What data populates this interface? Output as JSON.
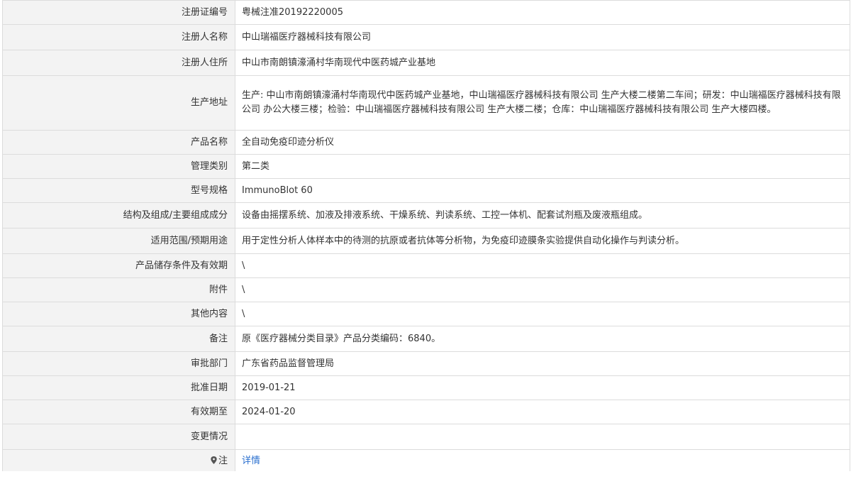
{
  "rows": [
    {
      "label": "注册证编号",
      "value": "粤械注准20192220005"
    },
    {
      "label": "注册人名称",
      "value": "中山瑞福医疗器械科技有限公司"
    },
    {
      "label": "注册人住所",
      "value": "中山市南朗镇濠涌村华南现代中医药城产业基地"
    },
    {
      "label": "生产地址",
      "value": "生产: 中山市南朗镇濠涌村华南现代中医药城产业基地，中山瑞福医疗器械科技有限公司 生产大楼二楼第二车间；研发：中山瑞福医疗器械科技有限公司 办公大楼三楼；检验：中山瑞福医疗器械科技有限公司 生产大楼二楼；仓库：中山瑞福医疗器械科技有限公司 生产大楼四楼。"
    },
    {
      "label": "产品名称",
      "value": "全自动免疫印迹分析仪"
    },
    {
      "label": "管理类别",
      "value": "第二类"
    },
    {
      "label": "型号规格",
      "value": "ImmunoBlot 60"
    },
    {
      "label": "结构及组成/主要组成成分",
      "value": "设备由摇摆系统、加液及排液系统、干燥系统、判读系统、工控一体机、配套试剂瓶及废液瓶组成。"
    },
    {
      "label": "适用范围/预期用途",
      "value": "用于定性分析人体样本中的待测的抗原或者抗体等分析物，为免疫印迹膜条实验提供自动化操作与判读分析。"
    },
    {
      "label": "产品储存条件及有效期",
      "value": "\\"
    },
    {
      "label": "附件",
      "value": "\\"
    },
    {
      "label": "其他内容",
      "value": "\\"
    },
    {
      "label": "备注",
      "value": "原《医疗器械分类目录》产品分类编码：6840。"
    },
    {
      "label": "审批部门",
      "value": "广东省药品监督管理局"
    },
    {
      "label": "批准日期",
      "value": "2019-01-21"
    },
    {
      "label": "有效期至",
      "value": "2024-01-20"
    },
    {
      "label": "变更情况",
      "value": ""
    }
  ],
  "note_row": {
    "label": "注",
    "icon": "map-pin-icon",
    "link_label": "详情",
    "link_color": "#2a6fcf"
  },
  "colors": {
    "label_background": "#f3f3f3",
    "border": "#dcdcdc",
    "text": "#333333"
  }
}
